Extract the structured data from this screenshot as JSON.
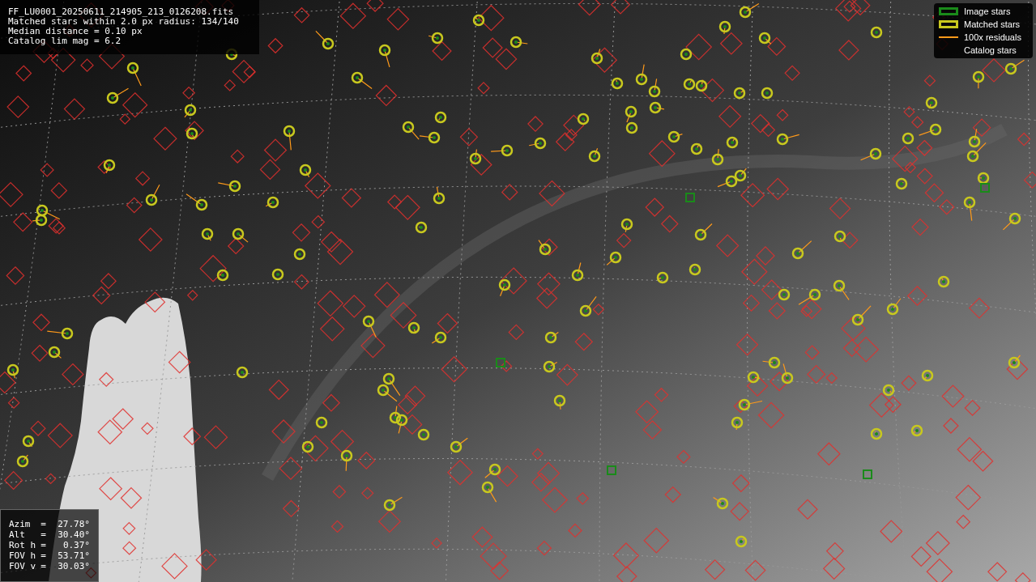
{
  "info": {
    "lines": [
      "FF_LU0001_20250611_214905_213_0126208.fits",
      "Matched stars within 2.0 px radius: 134/140",
      "Median distance = 0.10 px",
      "Catalog lim mag = 6.2"
    ]
  },
  "legend": [
    {
      "kind": "box",
      "label": "Image stars",
      "color": "#1a8a1a"
    },
    {
      "kind": "box",
      "label": "Matched stars",
      "color": "#c8c81e"
    },
    {
      "kind": "line",
      "label": "100x residuals",
      "color": "#ff9a1a"
    },
    {
      "kind": "none",
      "label": "Catalog stars"
    }
  ],
  "pointing": [
    {
      "label": "Azim",
      "sign": "=",
      "value": "27.78°"
    },
    {
      "label": "Alt",
      "sign": "=",
      "value": "30.40°"
    },
    {
      "label": "Rot h",
      "sign": "=",
      "value": "0.37°"
    },
    {
      "label": "FOV h",
      "sign": "=",
      "value": "53.71°"
    },
    {
      "label": "FOV v",
      "sign": "=",
      "value": "30.03°"
    }
  ]
}
